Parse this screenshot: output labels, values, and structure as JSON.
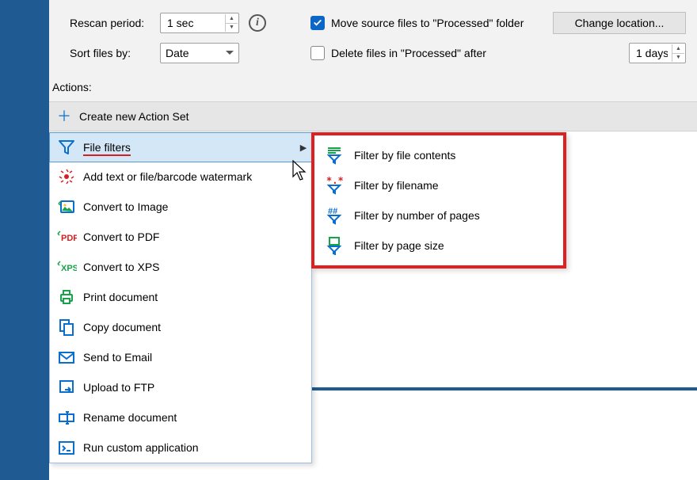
{
  "settings": {
    "rescan_label": "Rescan period:",
    "rescan_value": "1 sec",
    "sort_label": "Sort files by:",
    "sort_value": "Date",
    "move_label": "Move source files to \"Processed\" folder",
    "delete_label": "Delete files in \"Processed\" after",
    "change_location_label": "Change location...",
    "days_value": "1 days"
  },
  "actions_label": "Actions:",
  "toolbar": {
    "create_label": "Create new Action Set"
  },
  "menu": {
    "items": [
      {
        "label": "File filters"
      },
      {
        "label": "Add text or file/barcode watermark"
      },
      {
        "label": "Convert to Image"
      },
      {
        "label": "Convert to PDF"
      },
      {
        "label": "Convert to XPS"
      },
      {
        "label": "Print document"
      },
      {
        "label": "Copy document"
      },
      {
        "label": "Send to Email"
      },
      {
        "label": "Upload to FTP"
      },
      {
        "label": "Rename document"
      },
      {
        "label": "Run custom application"
      }
    ]
  },
  "submenu": {
    "items": [
      {
        "label": "Filter by file contents"
      },
      {
        "label": "Filter by filename"
      },
      {
        "label": "Filter by number of pages"
      },
      {
        "label": "Filter by page size"
      }
    ]
  }
}
